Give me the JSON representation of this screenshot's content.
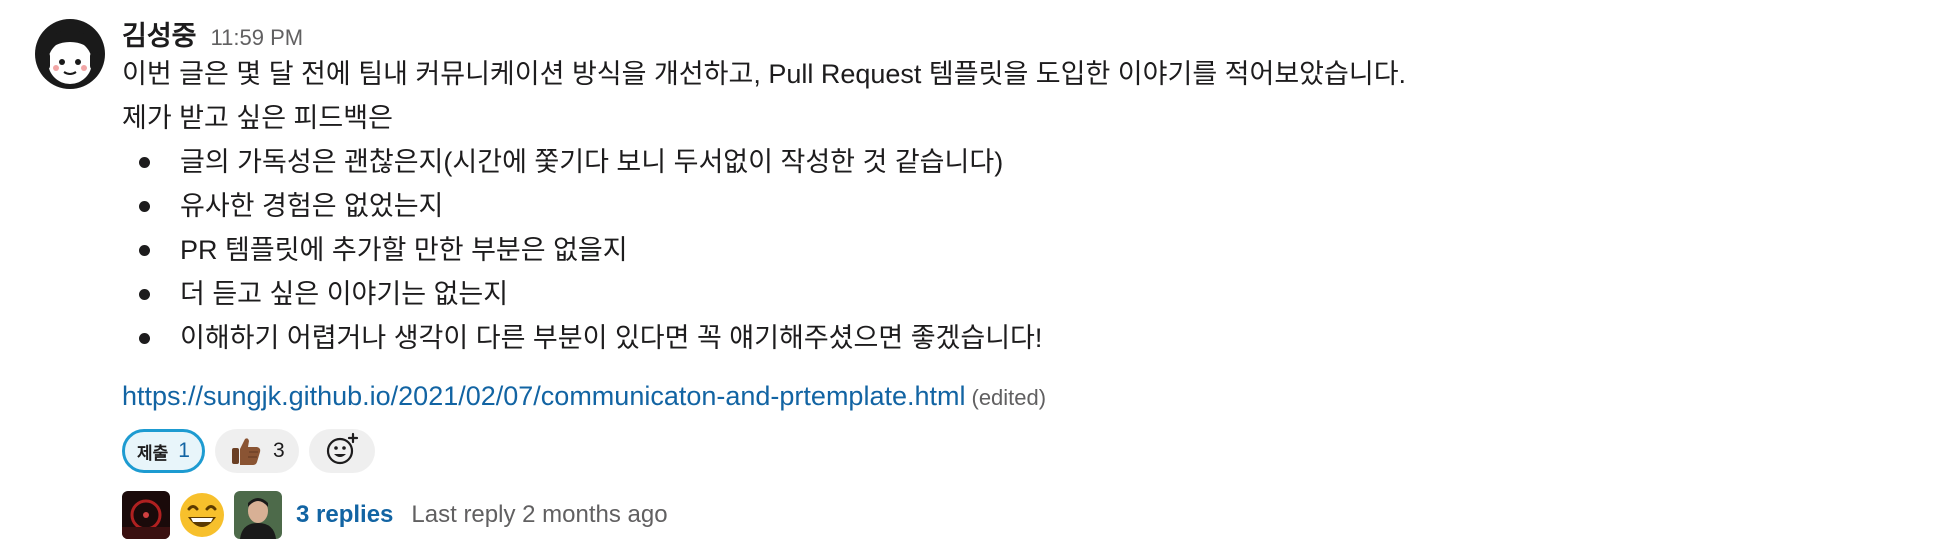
{
  "message": {
    "author": "김성중",
    "timestamp": "11:59 PM",
    "lines": [
      "이번 글은 몇 달 전에 팀내 커뮤니케이션 방식을 개선하고, Pull Request 템플릿을 도입한 이야기를 적어보았습니다.",
      "제가 받고 싶은 피드백은"
    ],
    "bullets": [
      "글의 가독성은 괜찮은지(시간에 쫓기다 보니 두서없이 작성한 것 같습니다)",
      "유사한 경험은 없었는지",
      "PR 템플릿에 추가할 만한 부분은 없을지",
      "더 듣고 싶은 이야기는 없는지",
      "이해하기 어렵거나 생각이 다른 부분이 있다면 꼭 얘기해주셨으면 좋겠습니다!"
    ],
    "link": "https://sungjk.github.io/2021/02/07/communicaton-and-prtemplate.html",
    "edited": "(edited)"
  },
  "reactions": [
    {
      "emoji_text": "제출",
      "count": "1",
      "active": true
    },
    {
      "emoji": "thumbs-up-icon",
      "count": "3",
      "active": false
    }
  ],
  "thread": {
    "replies": "3 replies",
    "last_reply": "Last reply 2 months ago"
  },
  "colors": {
    "link": "#1264a3",
    "active_reaction_border": "#1d9bd1",
    "muted_text": "#616061"
  }
}
